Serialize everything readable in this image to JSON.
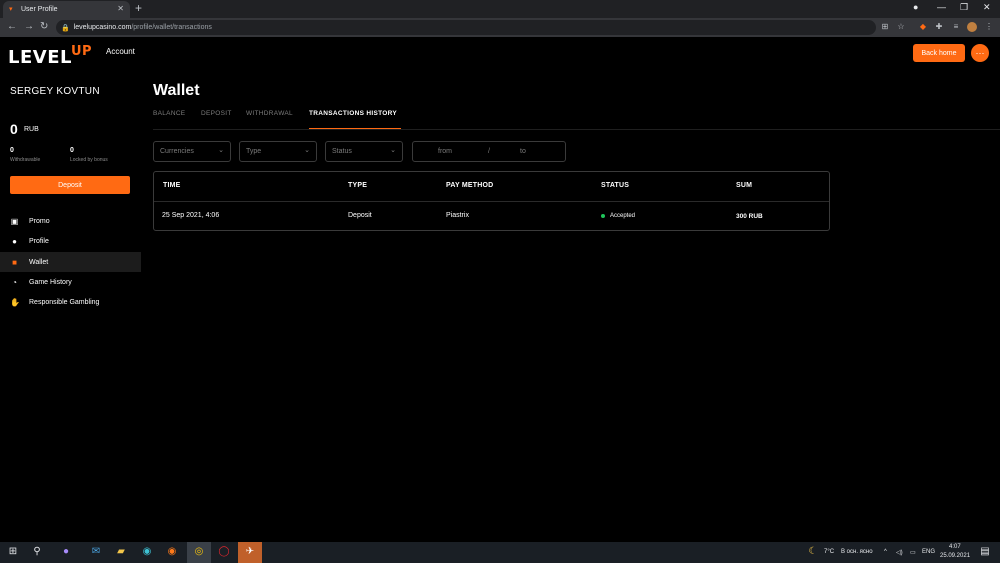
{
  "browser": {
    "tab_title": "User Profile",
    "tab_close": "✕",
    "new_tab": "+",
    "url_domain": "levelupcasino.com",
    "url_path": "/profile/wallet/transactions"
  },
  "header": {
    "logo_main": "LEVEL",
    "logo_accent": "UP",
    "section_label": "Account",
    "back_home": "Back home",
    "more": "···"
  },
  "sidebar": {
    "username": "SERGEY KOVTUN",
    "balance": "0",
    "balance_currency": "RUB",
    "withdrawable_value": "0",
    "withdrawable_label": "Withdrawable",
    "locked_value": "0",
    "locked_label": "Locked by bonus",
    "deposit_button": "Deposit",
    "items": [
      {
        "label": "Promo",
        "icon": "gift-icon"
      },
      {
        "label": "Profile",
        "icon": "user-icon"
      },
      {
        "label": "Wallet",
        "icon": "wallet-icon"
      },
      {
        "label": "Game History",
        "icon": "clock-icon"
      },
      {
        "label": "Responsible Gambling",
        "icon": "hand-icon"
      }
    ]
  },
  "main": {
    "title": "Wallet",
    "tabs": [
      "BALANCE",
      "DEPOSIT",
      "WITHDRAWAL",
      "TRANSACTIONS HISTORY"
    ],
    "active_tab": "TRANSACTIONS HISTORY",
    "filters": {
      "currencies": "Currencies",
      "type": "Type",
      "status": "Status",
      "date_from": "from",
      "date_sep": "/",
      "date_to": "to"
    },
    "table": {
      "headers": [
        "TIME",
        "TYPE",
        "PAY METHOD",
        "STATUS",
        "SUM"
      ],
      "rows": [
        {
          "time": "25 Sep 2021, 4:06",
          "type": "Deposit",
          "pay_method": "Piastrix",
          "status": "Accepted",
          "sum": "300 RUB"
        }
      ]
    }
  },
  "taskbar": {
    "weather": "7°C",
    "weather_text": "В осн. ясно",
    "lang": "ENG",
    "time": "4:07",
    "date": "25.09.2021"
  },
  "colors": {
    "accent": "#ff6a13",
    "status_accepted": "#1fc45a",
    "background": "#000000"
  }
}
